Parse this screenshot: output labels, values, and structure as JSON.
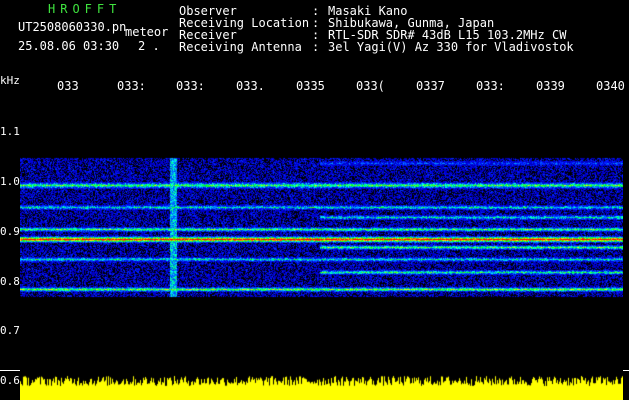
{
  "header": {
    "logo": "HROFFT",
    "filename": "UT2508060330.pn",
    "tag": "meteor",
    "datetime": "25.08.06 03:30",
    "count": "2 ."
  },
  "meta": [
    {
      "label": "Observer",
      "value": "Masaki Kano"
    },
    {
      "label": "Receiving Location",
      "value": "Shibukawa, Gunma, Japan"
    },
    {
      "label": "Receiver",
      "value": "RTL-SDR SDR# 43dB L15 103.2MHz CW"
    },
    {
      "label": "Receiving Antenna",
      "value": "3el Yagi(V) Az 330 for Vladivostok"
    }
  ],
  "meta_colon": ":",
  "axis": {
    "unit": "kHz",
    "time_ticks": [
      "033",
      "033:",
      "033:",
      "033.",
      "0335",
      "033(",
      "0337",
      "033:",
      "0339",
      "0340"
    ],
    "freq_labels": [
      "1.1",
      "1.0",
      "0.9",
      "0.8",
      "0.7",
      "0.6"
    ]
  },
  "colors": {
    "logo": "#3fe33f",
    "background": "#000000",
    "histogram": "#ffff00",
    "text": "#ffffff"
  }
}
